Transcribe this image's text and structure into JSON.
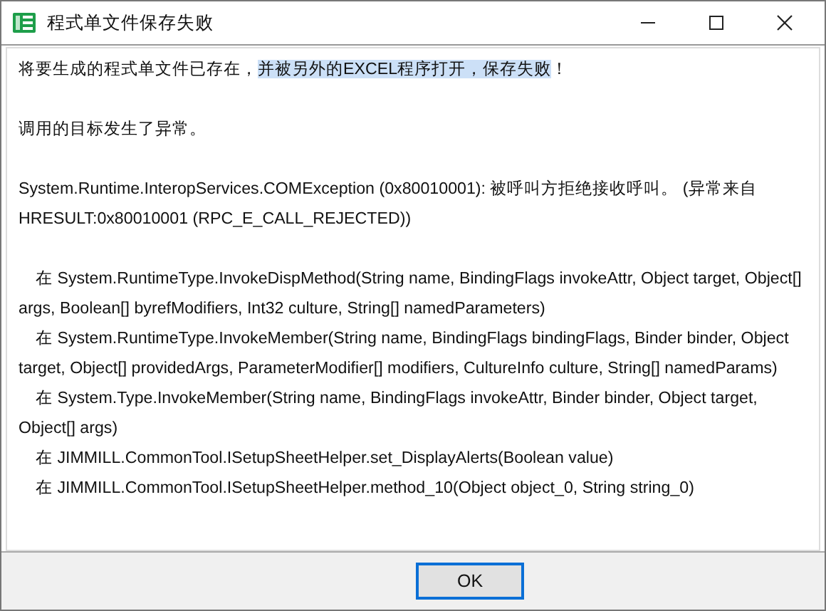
{
  "window": {
    "title": "程式单文件保存失败"
  },
  "message": [
    {
      "text": "将要生成的程式单文件已存在，",
      "selected": false
    },
    {
      "text": "并被另外的EXCEL程序打开，保存失败",
      "selected": true
    },
    {
      "text": "！",
      "selected": false
    }
  ],
  "paragraphs": [
    "调用的目标发生了异常。",
    "System.Runtime.InteropServices.COMException (0x80010001): 被呼叫方拒绝接收呼叫。 (异常来自 HRESULT:0x80010001 (RPC_E_CALL_REJECTED))"
  ],
  "stack_trace": [
    "在 System.RuntimeType.InvokeDispMethod(String name, BindingFlags invokeAttr, Object target, Object[] args, Boolean[] byrefModifiers, Int32 culture, String[] namedParameters)",
    "在 System.RuntimeType.InvokeMember(String name, BindingFlags bindingFlags, Binder binder, Object target, Object[] providedArgs, ParameterModifier[] modifiers, CultureInfo culture, String[] namedParams)",
    "在 System.Type.InvokeMember(String name, BindingFlags invokeAttr, Binder binder, Object target, Object[] args)",
    "在 JIMMILL.CommonTool.ISetupSheetHelper.set_DisplayAlerts(Boolean value)",
    "在 JIMMILL.CommonTool.ISetupSheetHelper.method_10(Object object_0, String string_0)"
  ],
  "buttons": [
    {
      "label": "OK"
    }
  ]
}
